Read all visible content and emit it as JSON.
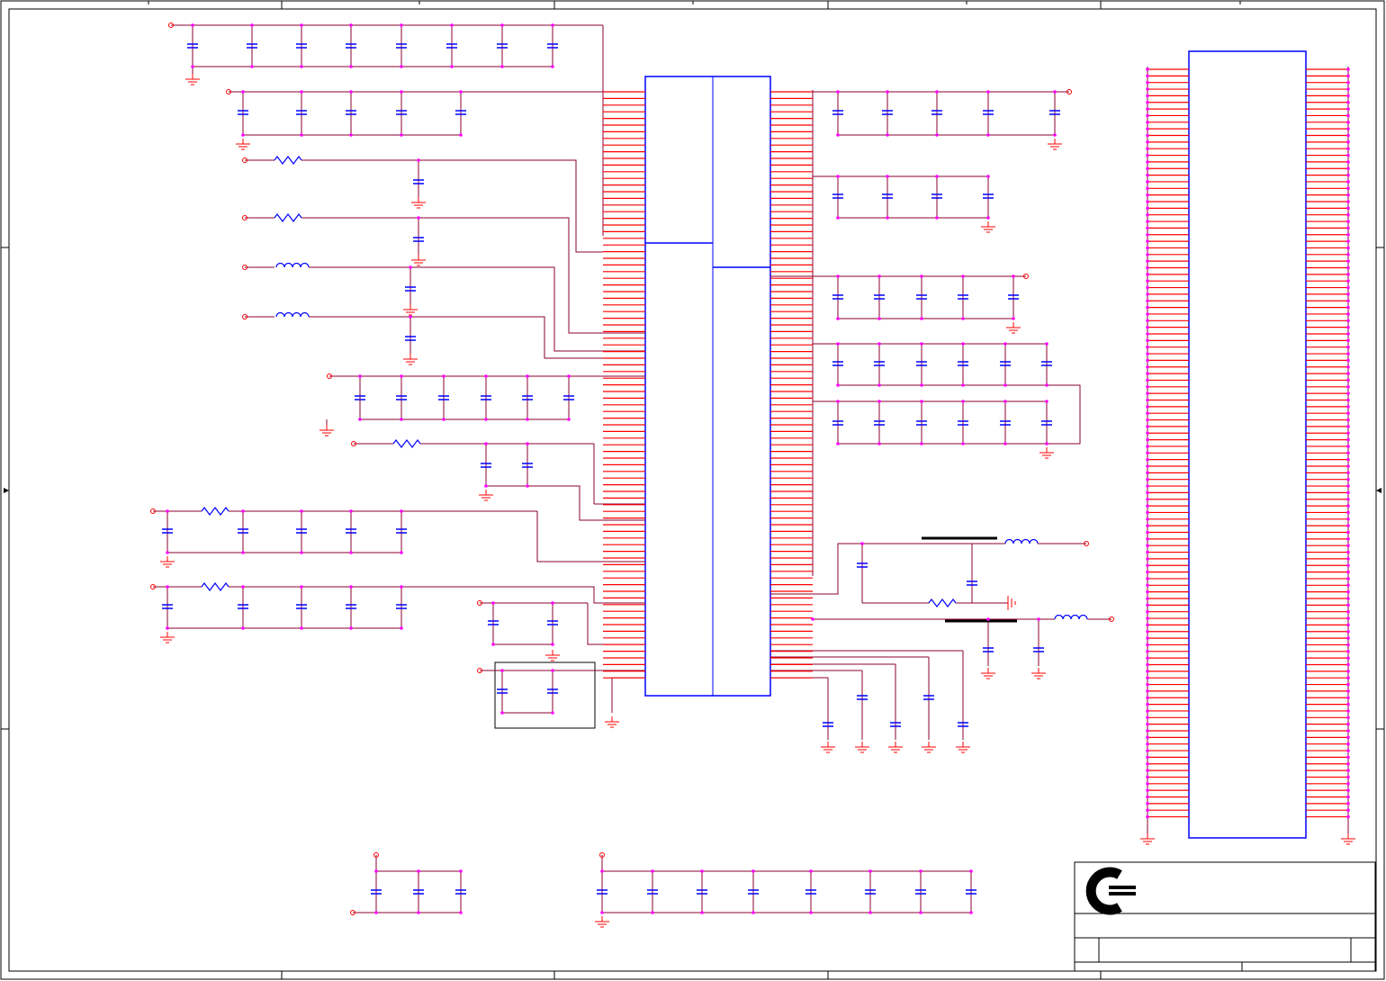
{
  "sheet": {
    "description_visible_text": "",
    "zones": {
      "top": [
        "",
        "",
        "",
        "",
        ""
      ],
      "side": [
        "",
        "",
        ""
      ]
    }
  },
  "colors": {
    "wire": "#8b0030",
    "pin": "#ff0000",
    "junction": "#ff00ff",
    "component": "#0000ff",
    "part_outline": "#0000ff",
    "border": "#000000",
    "bus_bar": "#000000"
  },
  "title_block": {
    "logo": "company-logo-c",
    "title": "",
    "doc_number": "",
    "rev": ""
  }
}
